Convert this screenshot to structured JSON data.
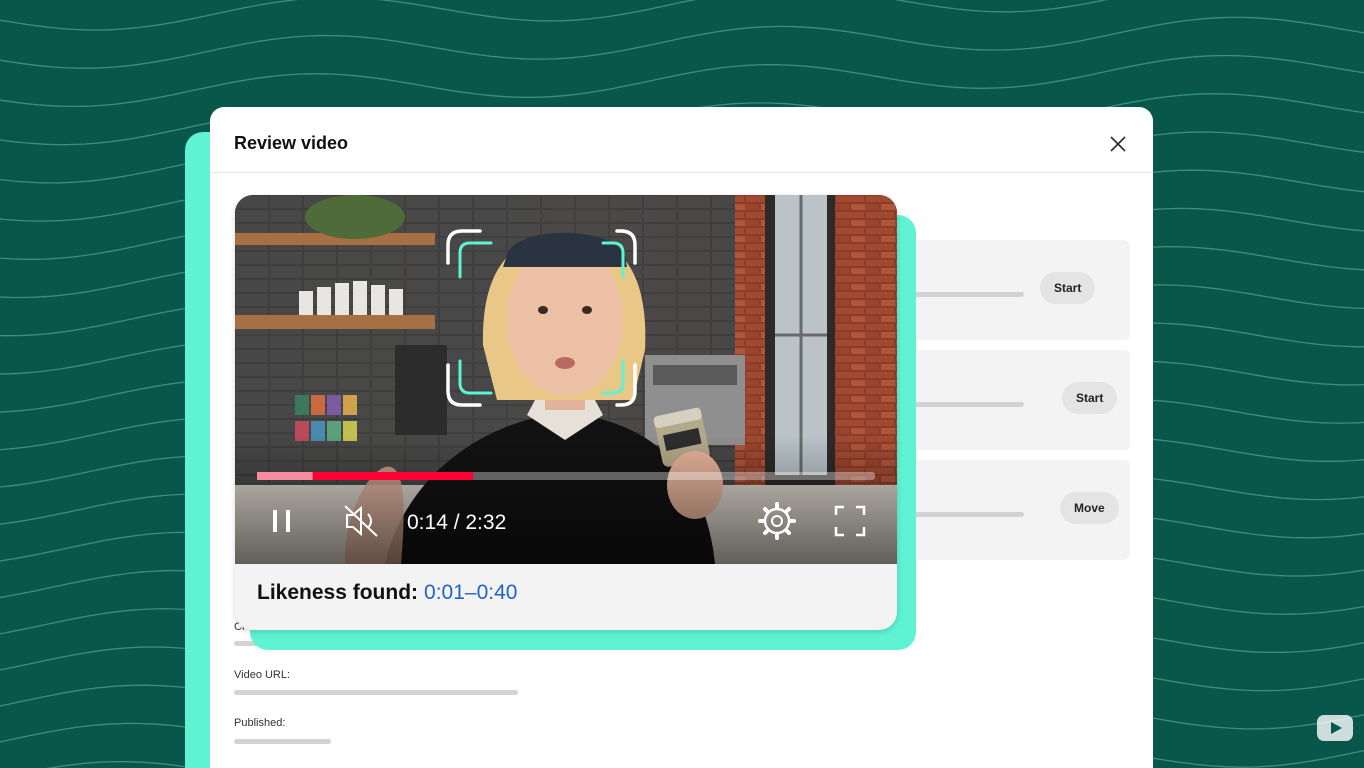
{
  "dialog": {
    "title": "Review video",
    "close_icon": "close-icon"
  },
  "tasks": [
    {
      "button": "Start"
    },
    {
      "button": "Start"
    },
    {
      "button": "Move"
    }
  ],
  "details": {
    "creator_label": "Cr",
    "url_label": "Video URL:",
    "published_label": "Published:"
  },
  "player": {
    "time_current": "0:14",
    "time_total": "2:32",
    "time_display": "0:14 / 2:32",
    "progress_played": 0.09,
    "progress_highlight_start": 0.0,
    "progress_highlight_end": 0.35,
    "controls": [
      "pause-icon",
      "mute-icon",
      "settings-icon",
      "fullscreen-icon"
    ]
  },
  "likeness": {
    "label": "Likeness found:",
    "range": "0:01–0:40"
  },
  "colors": {
    "background": "#08574a",
    "accent": "#5ff2d3",
    "progress_red": "#ff0033",
    "progress_pink": "#f58ba0",
    "range_blue": "#1f63c6"
  }
}
